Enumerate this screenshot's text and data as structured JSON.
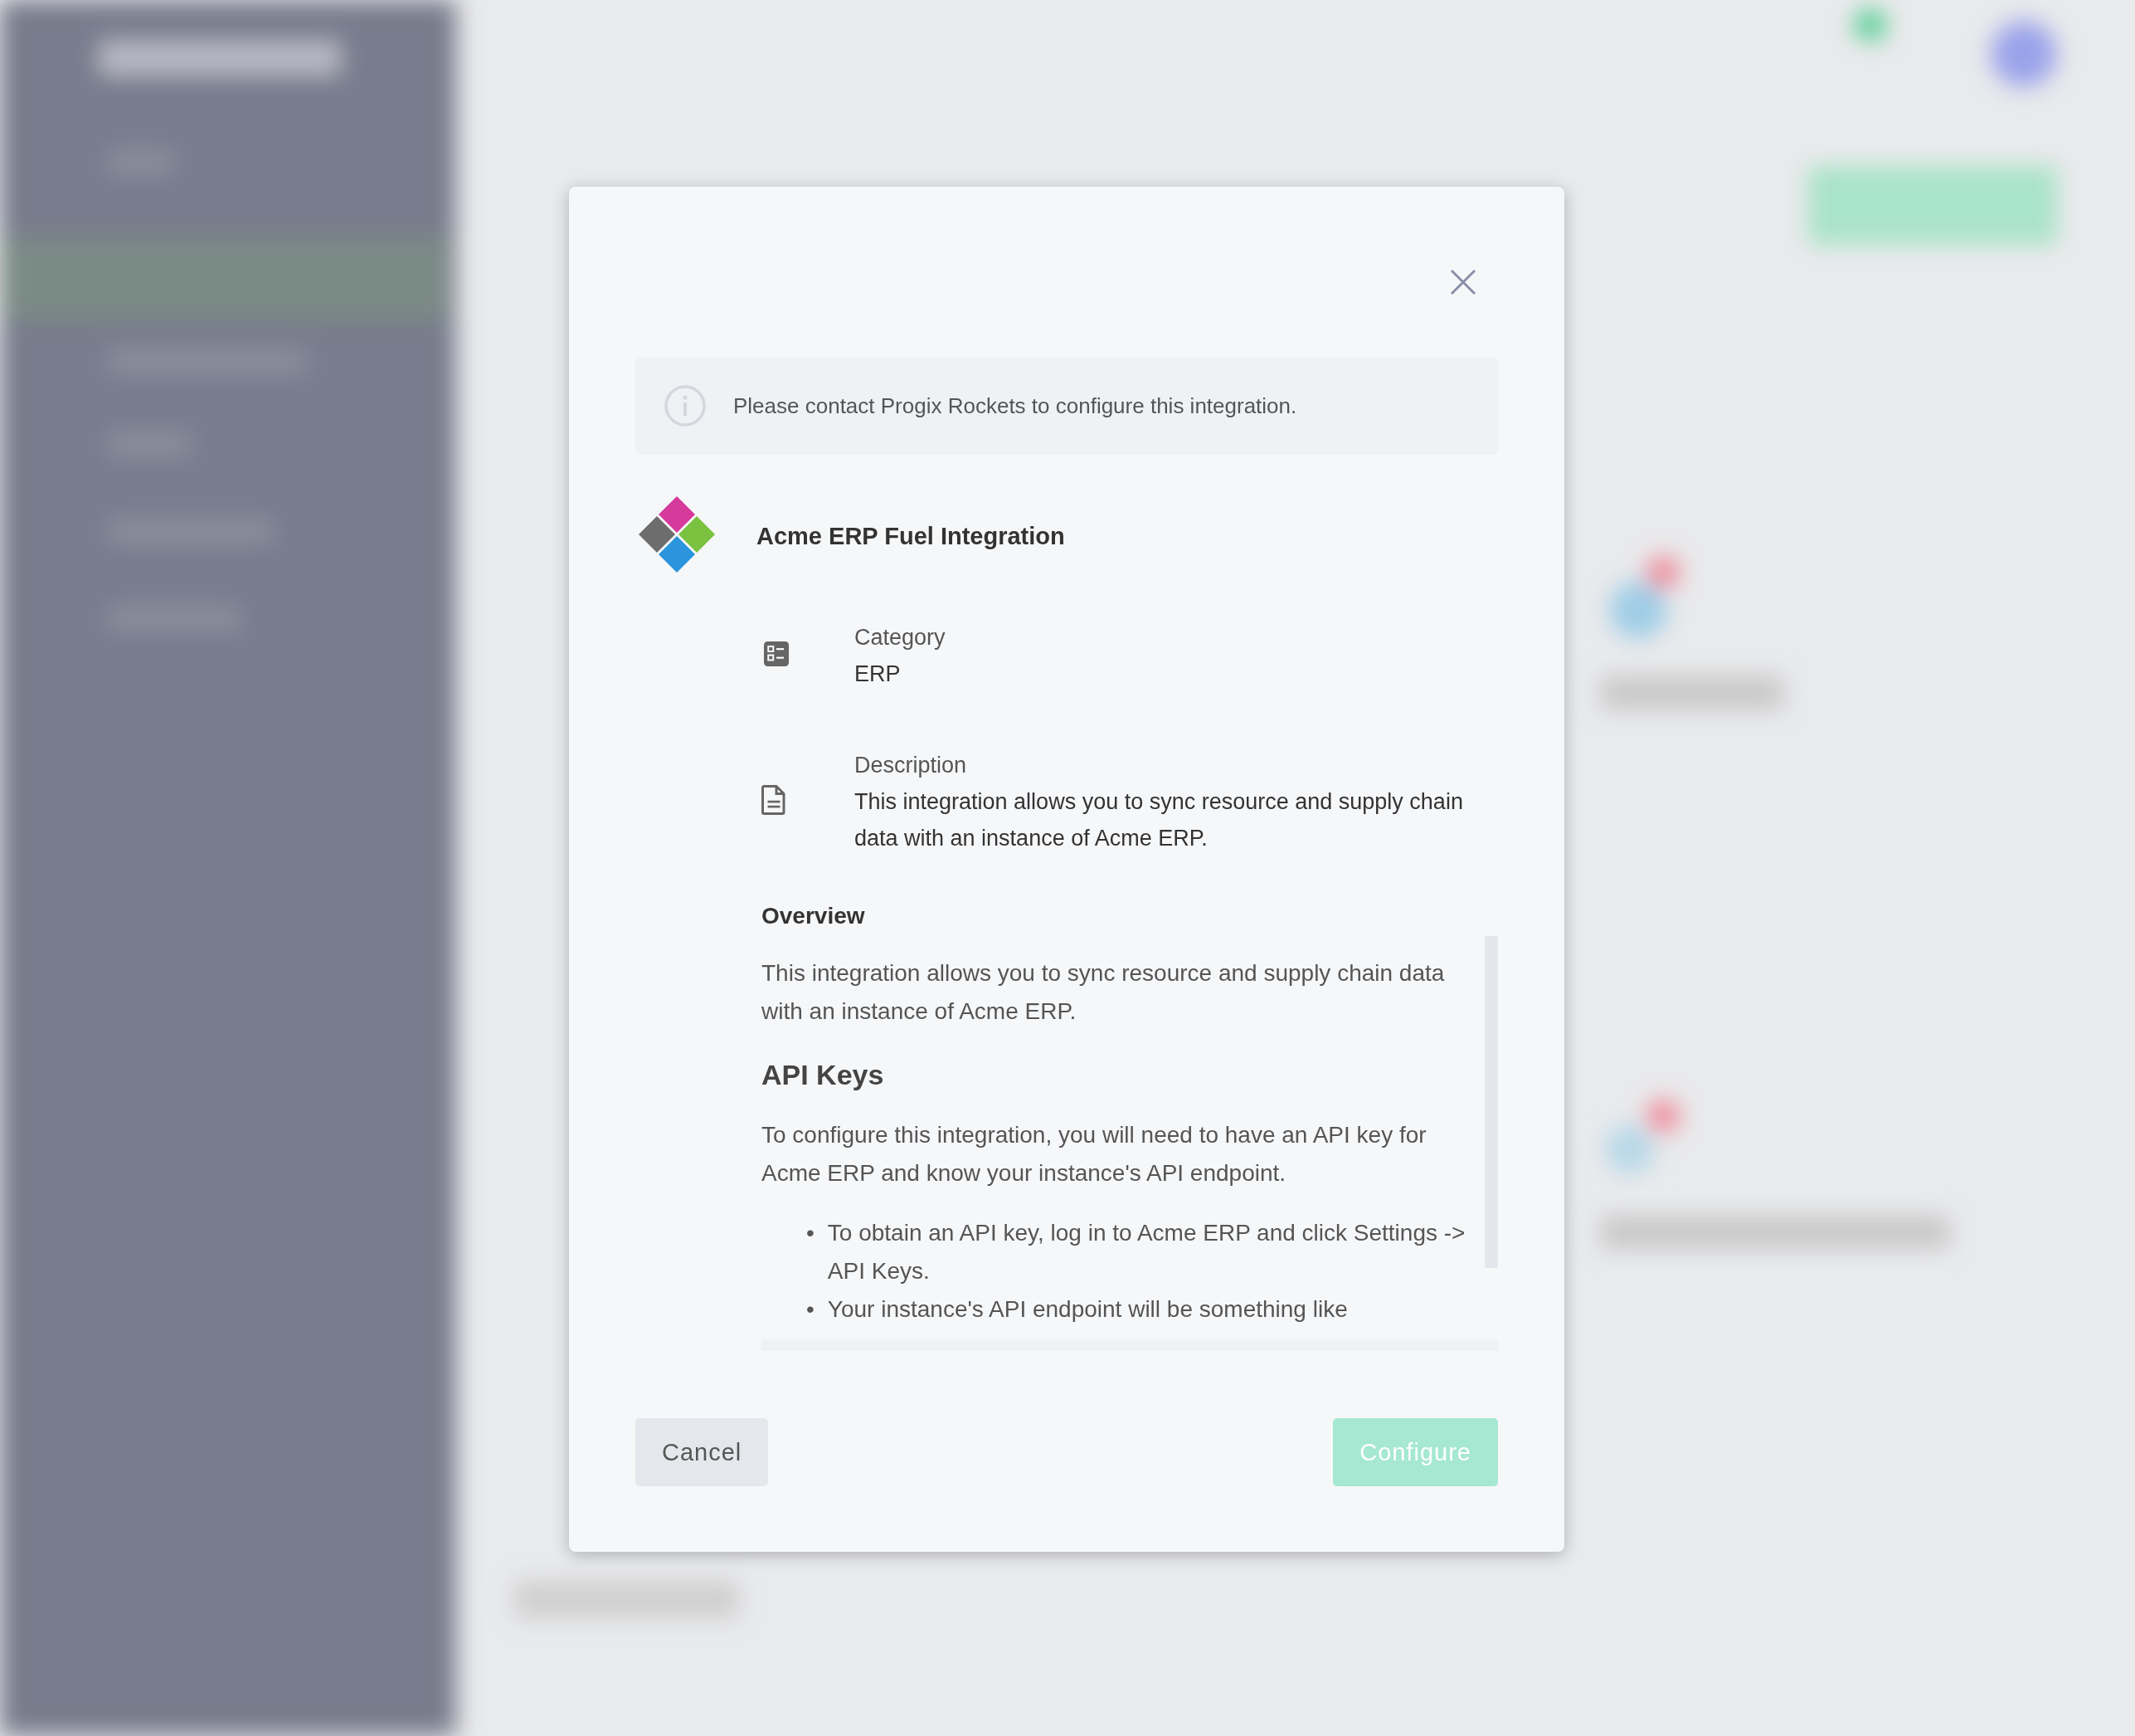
{
  "dialog": {
    "notice": "Please contact Progix Rockets to configure this integration.",
    "title": "Acme ERP Fuel Integration",
    "details": [
      {
        "kind": "category",
        "label": "Category",
        "value": "ERP"
      },
      {
        "kind": "description",
        "label": "Description",
        "value": "This integration allows you to sync resource and supply chain data with an instance of Acme ERP."
      }
    ],
    "overview_heading": "Overview",
    "overview": [
      {
        "kind": "paragraph",
        "text": "This integration allows you to sync resource and supply chain data with an instance of Acme ERP."
      },
      {
        "kind": "heading",
        "text": "API Keys"
      },
      {
        "kind": "paragraph",
        "text": "To configure this integration, you will need to have an API key for Acme ERP and know your instance's API endpoint."
      },
      {
        "kind": "bullets",
        "items": [
          {
            "marker": "•",
            "text": "To obtain an API key, log in to Acme ERP and click Settings -> API Keys."
          },
          {
            "marker": "•",
            "text": "Your instance's API endpoint will be something like"
          }
        ]
      }
    ],
    "buttons": [
      {
        "kind": "secondary",
        "label": "Cancel",
        "disabled": false
      },
      {
        "kind": "primary",
        "label": "Configure",
        "disabled": true
      }
    ]
  }
}
